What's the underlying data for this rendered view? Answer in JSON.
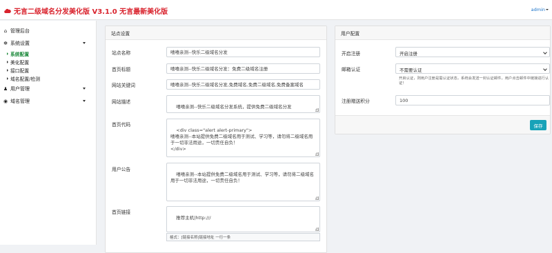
{
  "app": {
    "title": "无言二级域名分发美化版 V3.1.0 无言最新美化版",
    "user": "admin"
  },
  "sidebar": {
    "items": [
      {
        "label": "管理后台",
        "icon": "home-icon"
      },
      {
        "label": "系统设置",
        "icon": "gear-icon",
        "expanded": true,
        "children": [
          {
            "label": "系统配置",
            "active": true
          },
          {
            "label": "美化配置"
          },
          {
            "label": "接口配置"
          },
          {
            "label": "域名配置/检测"
          }
        ]
      },
      {
        "label": "用户管理",
        "icon": "user-icon"
      },
      {
        "label": "域名管理",
        "icon": "globe-icon"
      }
    ]
  },
  "site": {
    "header": "站点设置",
    "name_label": "站点名称",
    "name_value": "嘻嘻亲测--快乐二级域名分发",
    "title_label": "首页标题",
    "title_value": "嘻嘻亲测--快乐二级域名分发：免费二级域名注册",
    "keywords_label": "网站关键词",
    "keywords_value": "嘻嘻亲测--快乐二级域名分发,免费域名,免费二级域名,免费备案域名",
    "desc_label": "网站描述",
    "desc_value": "嘻嘻亲测--快乐二级域名分发系统，提供免费二级域名分发",
    "homecode_label": "首页代码",
    "homecode_value": "<div class=\"alert alert-primary\">\n嘻嘻亲测--本站提供免费二级域名用于测试、学习等，请勿将二级域名用于一切非法用途，一切责任自负！\n</div>",
    "notice_label": "用户公告",
    "notice_value": "嘻嘻亲测--本站提供免费二级域名用于测试、学习等，请勿将二级域名用于一切非法用途，一切责任自负！",
    "links_label": "首页链接",
    "links_value": "推荐主机|http:///",
    "links_hint": "格式：[链接名称|链接地址 一行一条"
  },
  "user_cfg": {
    "header": "用户配置",
    "register_label": "开启注册",
    "register_value": "开启注册",
    "email_label": "邮箱认证",
    "email_value": "不需要认证",
    "email_help": "开启认证，则用户注册是需认证状态，系统会发送一封认证邮件，用户点击邮件中链接进行认证！",
    "points_label": "注册赠送积分",
    "points_value": "100",
    "save_label": "保存"
  },
  "colors": {
    "brand": "#d9232d",
    "active_nav": "#1e8a3c",
    "save_button": "#17a2b8",
    "user_link": "#1a73c9"
  }
}
